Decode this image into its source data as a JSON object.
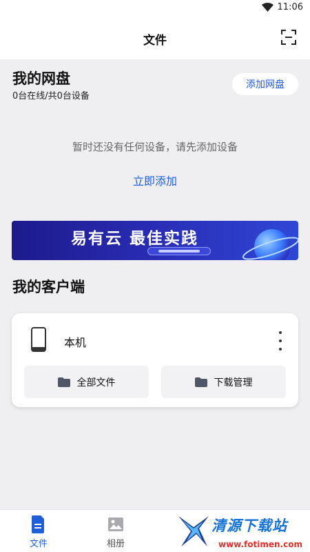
{
  "status_bar": {
    "time": "11:06"
  },
  "header": {
    "title": "文件"
  },
  "my_disk": {
    "title": "我的网盘",
    "device_count": "0台在线/共0台设备",
    "add_button": "添加网盘",
    "empty_message": "暂时还没有任何设备，请先添加设备",
    "add_now_link": "立即添加"
  },
  "banner": {
    "text": "易有云 最佳实践"
  },
  "my_clients": {
    "title": "我的客户端",
    "device": {
      "name": "本机",
      "buttons": [
        {
          "label": "全部文件"
        },
        {
          "label": "下载管理"
        }
      ]
    }
  },
  "tab_bar": {
    "tabs": [
      {
        "label": "文件",
        "active": true
      },
      {
        "label": "相册",
        "active": false
      }
    ]
  },
  "watermark": {
    "text": "清源下载站",
    "url": "www.fotimen.com"
  },
  "colors": {
    "accent": "#1e5fd9",
    "background": "#efeff1",
    "banner": "#2a2fb8"
  }
}
